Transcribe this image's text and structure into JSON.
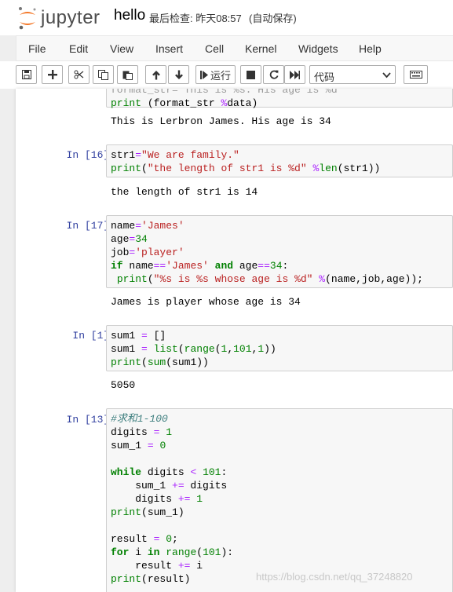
{
  "header": {
    "logo_text": "jupyter",
    "notebook_name": "hello",
    "checkpoint": "最后检查: 昨天08:57",
    "autosave": "(自动保存)"
  },
  "menu": [
    "File",
    "Edit",
    "View",
    "Insert",
    "Cell",
    "Kernel",
    "Widgets",
    "Help"
  ],
  "toolbar": {
    "run_label": "运行",
    "cell_type": "代码",
    "icons": [
      "save-icon",
      "plus-icon",
      "cut-icon",
      "copy-icon",
      "paste-icon",
      "arrow-up-icon",
      "arrow-down-icon",
      "step-forward-icon",
      "stop-icon",
      "refresh-icon",
      "fast-forward-icon",
      "keyboard-icon"
    ]
  },
  "cells": [
    {
      "prompt": "",
      "output": "This is Lerbron James. His age is 34"
    },
    {
      "prompt": "In [16]:",
      "output": "the length of str1 is 14"
    },
    {
      "prompt": "In [17]:",
      "output": "James is player whose age is 34"
    },
    {
      "prompt": "In [1]:",
      "output": "5050"
    },
    {
      "prompt": "In [13]:",
      "output": ""
    }
  ],
  "watermark": "https://blog.csdn.net/qq_37248820"
}
